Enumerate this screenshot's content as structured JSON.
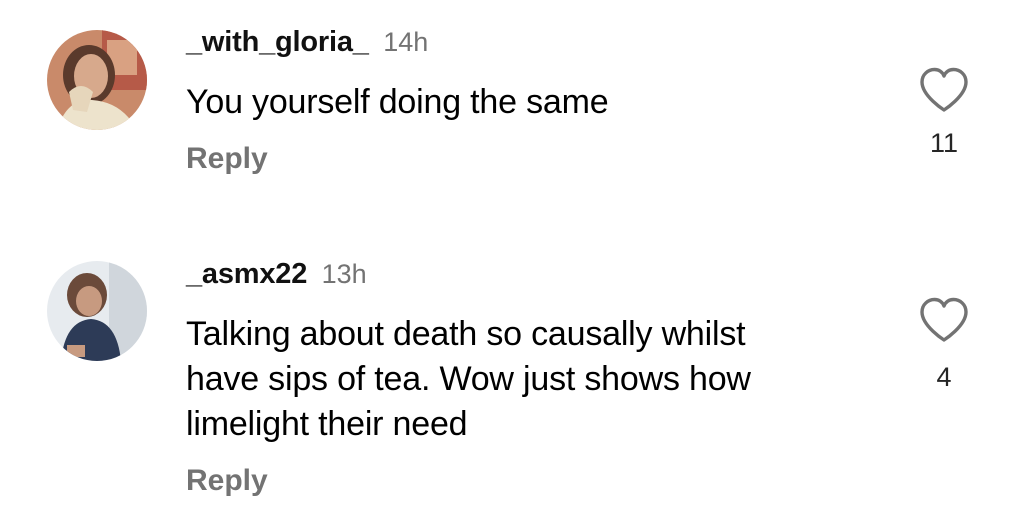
{
  "comments": [
    {
      "username": "_with_gloria_",
      "time": "14h",
      "text": "You yourself doing the same",
      "reply_label": "Reply",
      "likes": "11",
      "avatar_icon": "user-avatar-photo",
      "like_icon": "heart-outline-icon"
    },
    {
      "username": "_asmx22",
      "time": "13h",
      "text": "Talking about death so causally whilst have sips of tea. Wow just shows how limelight their need",
      "reply_label": "Reply",
      "likes": "4",
      "avatar_icon": "user-avatar-photo",
      "like_icon": "heart-outline-icon"
    }
  ],
  "colors": {
    "text": "#000000",
    "secondary": "#737373",
    "like_count": "#262626",
    "heart_stroke": "#737373"
  }
}
